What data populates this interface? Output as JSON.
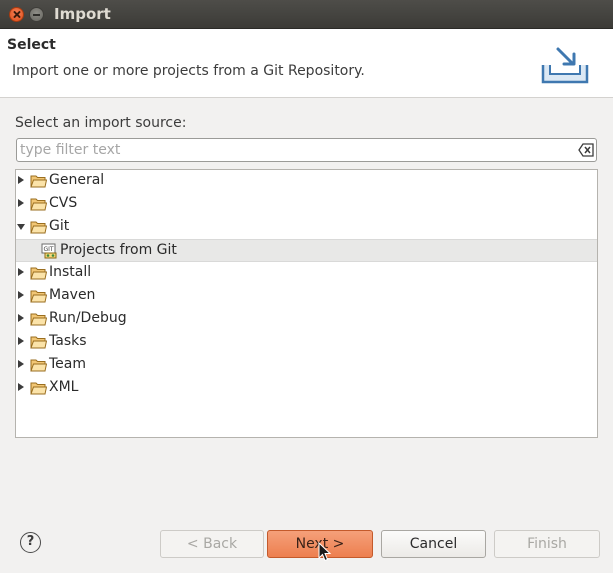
{
  "window": {
    "title": "Import"
  },
  "header": {
    "title": "Select",
    "description": "Import one or more projects from a Git Repository.",
    "icon": "import-wizard-icon"
  },
  "source": {
    "label": "Select an import source:",
    "filter_placeholder": "type filter text",
    "filter_value": ""
  },
  "tree": {
    "items": [
      {
        "label": "General",
        "expanded": false
      },
      {
        "label": "CVS",
        "expanded": false
      },
      {
        "label": "Git",
        "expanded": true
      },
      {
        "label": "Projects from Git",
        "child": true,
        "selected": true,
        "icon": "git-icon"
      },
      {
        "label": "Install",
        "expanded": false
      },
      {
        "label": "Maven",
        "expanded": false
      },
      {
        "label": "Run/Debug",
        "expanded": false
      },
      {
        "label": "Tasks",
        "expanded": false
      },
      {
        "label": "Team",
        "expanded": false
      },
      {
        "label": "XML",
        "expanded": false
      }
    ]
  },
  "buttons": {
    "help": "?",
    "back": "< Back",
    "next": "Next >",
    "cancel": "Cancel",
    "finish": "Finish"
  },
  "colors": {
    "accent": "#ed7f4f",
    "titlebar": "#3c3b37",
    "folder": "#e0a94f"
  }
}
